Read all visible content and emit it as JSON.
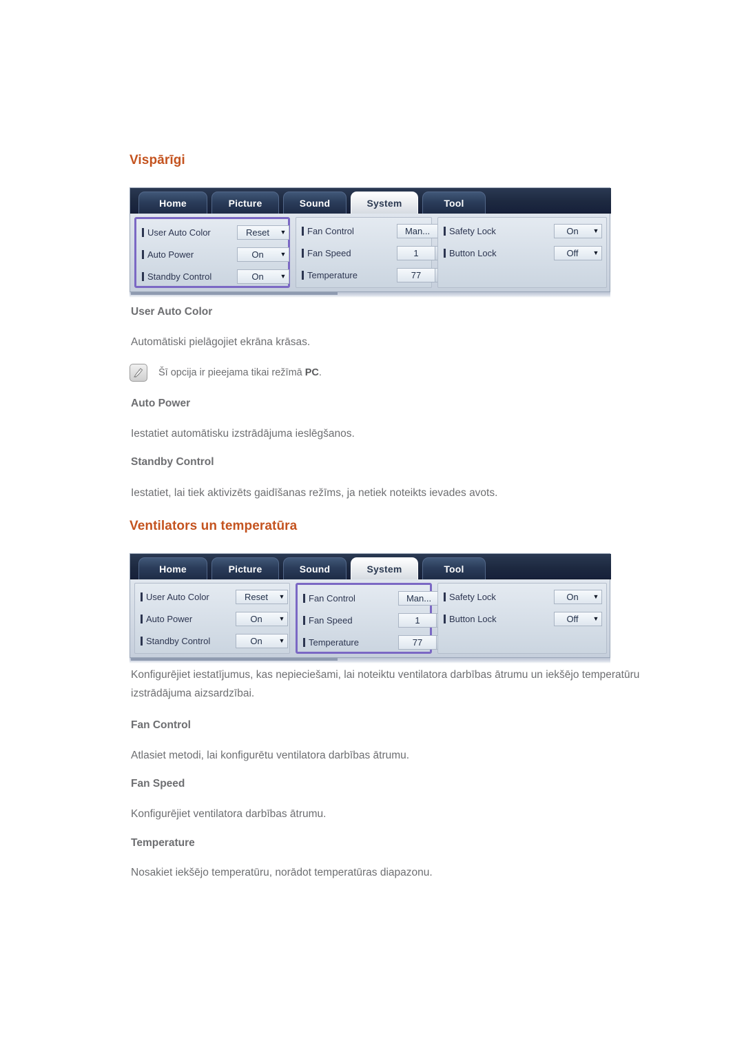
{
  "document": {
    "language": "lv",
    "accent_color": "#c4531f",
    "body_color": "#6d6e71",
    "highlight_color": "#7b68c4"
  },
  "sections": [
    {
      "heading": "Vispārīgi",
      "osd": {
        "tabs": [
          {
            "label": "Home",
            "active": false
          },
          {
            "label": "Picture",
            "active": false
          },
          {
            "label": "Sound",
            "active": false
          },
          {
            "label": "System",
            "active": true
          },
          {
            "label": "Tool",
            "active": false
          }
        ],
        "columns": [
          {
            "highlighted": true,
            "rows": [
              {
                "label": "User Auto Color",
                "value": "Reset",
                "control": "dropdown"
              },
              {
                "label": "Auto Power",
                "value": "On",
                "control": "dropdown"
              },
              {
                "label": "Standby Control",
                "value": "On",
                "control": "dropdown"
              }
            ]
          },
          {
            "highlighted": false,
            "rows": [
              {
                "label": "Fan Control",
                "value": "Man...",
                "control": "dropdown"
              },
              {
                "label": "Fan Speed",
                "value": "1",
                "control": "stepper"
              },
              {
                "label": "Temperature",
                "value": "77",
                "control": "stepper"
              }
            ]
          },
          {
            "highlighted": false,
            "rows": [
              {
                "label": "Safety Lock",
                "value": "On",
                "control": "dropdown"
              },
              {
                "label": "Button Lock",
                "value": "Off",
                "control": "dropdown"
              }
            ]
          }
        ]
      },
      "items": [
        {
          "title": "User Auto Color",
          "text": "Automātiski pielāgojiet ekrāna krāsas."
        },
        {
          "title": "Auto Power",
          "text": "Iestatiet automātisku izstrādājuma ieslēgšanos."
        },
        {
          "title": "Standby Control",
          "text": "Iestatiet, lai tiek aktivizēts gaidīšanas režīms, ja netiek noteikts ievades avots."
        }
      ],
      "note": {
        "icon": "note-pencil-icon",
        "text_before": "Šī opcija ir pieejama tikai režīmā ",
        "text_bold": "PC",
        "text_after": "."
      }
    },
    {
      "heading": "Ventilators un temperatūra",
      "osd": {
        "tabs": [
          {
            "label": "Home",
            "active": false
          },
          {
            "label": "Picture",
            "active": false
          },
          {
            "label": "Sound",
            "active": false
          },
          {
            "label": "System",
            "active": true
          },
          {
            "label": "Tool",
            "active": false
          }
        ],
        "columns": [
          {
            "highlighted": false,
            "rows": [
              {
                "label": "User Auto Color",
                "value": "Reset",
                "control": "dropdown"
              },
              {
                "label": "Auto Power",
                "value": "On",
                "control": "dropdown"
              },
              {
                "label": "Standby Control",
                "value": "On",
                "control": "dropdown"
              }
            ]
          },
          {
            "highlighted": true,
            "rows": [
              {
                "label": "Fan Control",
                "value": "Man...",
                "control": "dropdown"
              },
              {
                "label": "Fan Speed",
                "value": "1",
                "control": "stepper"
              },
              {
                "label": "Temperature",
                "value": "77",
                "control": "stepper"
              }
            ]
          },
          {
            "highlighted": false,
            "rows": [
              {
                "label": "Safety Lock",
                "value": "On",
                "control": "dropdown"
              },
              {
                "label": "Button Lock",
                "value": "Off",
                "control": "dropdown"
              }
            ]
          }
        ]
      },
      "intro": "Konfigurējiet iestatījumus, kas nepieciešami, lai noteiktu ventilatora darbības ātrumu un iekšējo temperatūru izstrādājuma aizsardzībai.",
      "items": [
        {
          "title": "Fan Control",
          "text": "Atlasiet metodi, lai konfigurētu ventilatora darbības ātrumu."
        },
        {
          "title": "Fan Speed",
          "text": "Konfigurējiet ventilatora darbības ātrumu."
        },
        {
          "title": "Temperature",
          "text": "Nosakiet iekšējo temperatūru, norādot temperatūras diapazonu."
        }
      ]
    }
  ]
}
